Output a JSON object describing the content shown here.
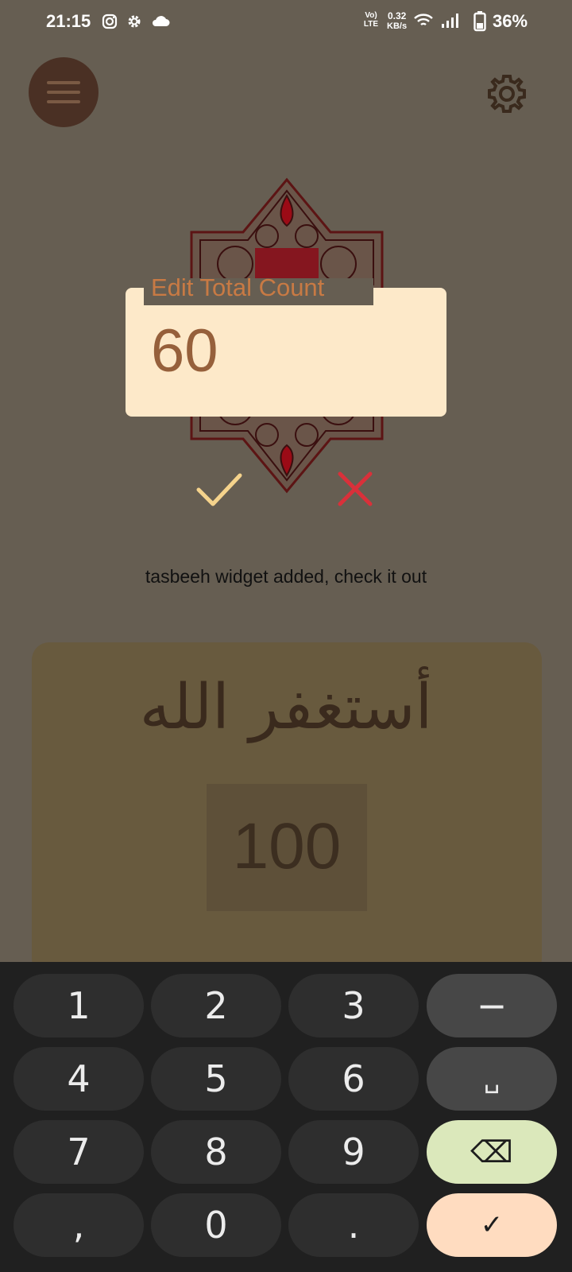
{
  "status": {
    "time": "21:15",
    "network_type": "Vo) LTE",
    "speed_value": "0.32",
    "speed_unit": "KB/s",
    "battery": "36%",
    "left_icons": [
      "instagram-icon",
      "settings-gear-icon",
      "cloud-icon"
    ],
    "right_icons": [
      "volte-icon",
      "wifi-icon",
      "signal-icon",
      "battery-icon"
    ]
  },
  "app": {
    "menu_icon": "hamburger-menu-icon",
    "settings_icon": "settings-gear-icon"
  },
  "dialog": {
    "label": "Edit Total Count",
    "value": "60",
    "confirm_icon": "check-icon",
    "cancel_icon": "close-icon"
  },
  "toast": "tasbeeh widget added, check it out",
  "counter": {
    "dhikr": "أستغفر الله",
    "count": "100"
  },
  "keyboard": {
    "rows": [
      [
        "1",
        "2",
        "3",
        "−"
      ],
      [
        "4",
        "5",
        "6",
        "␣"
      ],
      [
        "7",
        "8",
        "9",
        "⌫"
      ],
      [
        ",",
        "0",
        ".",
        "✓"
      ]
    ]
  },
  "colors": {
    "background": "#665e52",
    "field": "#fde9c9",
    "label": "#c87a44",
    "confirm": "#f5d38c",
    "cancel": "#d9303a",
    "delete_key": "#dbe8bb",
    "enter_key": "#ffdcc0"
  }
}
